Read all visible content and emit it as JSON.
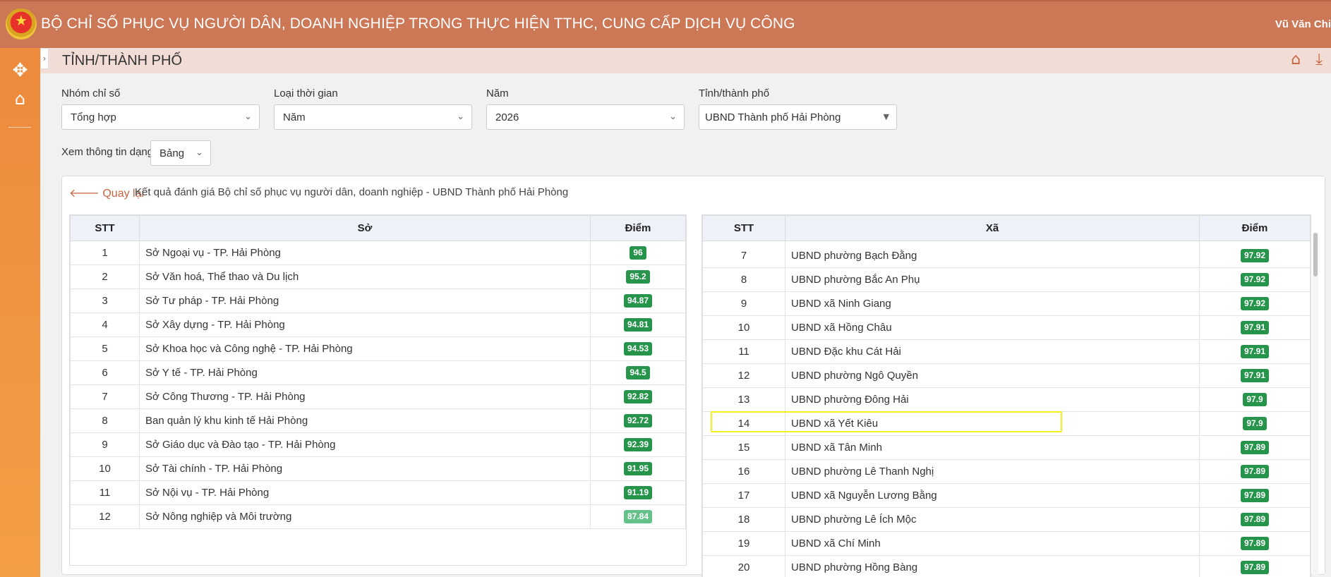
{
  "header": {
    "title": "BỘ CHỈ SỐ PHỤC VỤ NGƯỜI DÂN, DOANH NGHIỆP TRONG THỰC HIỆN TTHC, CUNG CẤP DỊCH VỤ CÔNG",
    "user": "Vũ Văn Chi",
    "emblem_icon": "national-emblem-icon"
  },
  "sidebar": {
    "items": [
      {
        "icon": "compass-icon"
      },
      {
        "icon": "home-icon"
      }
    ]
  },
  "subheader": {
    "title": "TỈNH/THÀNH PHỐ",
    "icons": [
      "home-icon",
      "download-icon"
    ]
  },
  "filters": {
    "group_label": "Nhóm chỉ số",
    "group_value": "Tổng hợp",
    "time_label": "Loại thời gian",
    "time_value": "Năm",
    "year_label": "Năm",
    "year_value": "2026",
    "province_label": "Tỉnh/thành phố",
    "province_value": "UBND Thành phố Hải Phòng",
    "view_label": "Xem thông tin dạng",
    "view_value": "Bảng"
  },
  "panel": {
    "back_label": "Quay lại",
    "description": "Kết quả đánh giá Bộ chỉ số phục vụ người dân, doanh nghiệp - UBND Thành phố Hải Phòng"
  },
  "left_table": {
    "headers": [
      "STT",
      "Sở",
      "Điểm"
    ],
    "rows": [
      {
        "stt": "1",
        "name": "Sở Ngoại vụ - TP. Hải Phòng",
        "score": "96"
      },
      {
        "stt": "2",
        "name": "Sở Văn hoá, Thể thao và Du lịch",
        "score": "95.2"
      },
      {
        "stt": "3",
        "name": "Sở Tư pháp - TP. Hải Phòng",
        "score": "94.87"
      },
      {
        "stt": "4",
        "name": "Sở Xây dựng - TP. Hải Phòng",
        "score": "94.81"
      },
      {
        "stt": "5",
        "name": "Sở Khoa học và Công nghệ - TP. Hải Phòng",
        "score": "94.53"
      },
      {
        "stt": "6",
        "name": "Sở Y tế - TP. Hải Phòng",
        "score": "94.5"
      },
      {
        "stt": "7",
        "name": "Sở Công Thương - TP. Hải Phòng",
        "score": "92.82"
      },
      {
        "stt": "8",
        "name": "Ban quản lý khu kinh tế Hải Phòng",
        "score": "92.72"
      },
      {
        "stt": "9",
        "name": "Sở Giáo dục và Đào tạo - TP. Hải Phòng",
        "score": "92.39"
      },
      {
        "stt": "10",
        "name": "Sở Tài chính - TP. Hải Phòng",
        "score": "91.95"
      },
      {
        "stt": "11",
        "name": "Sở Nội vụ - TP. Hải Phòng",
        "score": "91.19"
      },
      {
        "stt": "12",
        "name": "Sở Nông nghiệp và Môi trường",
        "score": "87.84"
      }
    ]
  },
  "right_table": {
    "headers": [
      "STT",
      "Xã",
      "Điểm"
    ],
    "rows": [
      {
        "stt": "7",
        "name": "UBND phường Bạch Đằng",
        "score": "97.92"
      },
      {
        "stt": "8",
        "name": "UBND phường Bắc An Phụ",
        "score": "97.92"
      },
      {
        "stt": "9",
        "name": "UBND xã Ninh Giang",
        "score": "97.92"
      },
      {
        "stt": "10",
        "name": "UBND xã Hồng Châu",
        "score": "97.91"
      },
      {
        "stt": "11",
        "name": "UBND Đặc khu Cát Hải",
        "score": "97.91"
      },
      {
        "stt": "12",
        "name": "UBND phường Ngô Quyền",
        "score": "97.91"
      },
      {
        "stt": "13",
        "name": "UBND phường Đông Hải",
        "score": "97.9"
      },
      {
        "stt": "14",
        "name": "UBND xã Yết Kiêu",
        "score": "97.9"
      },
      {
        "stt": "15",
        "name": "UBND xã Tân Minh",
        "score": "97.89"
      },
      {
        "stt": "16",
        "name": "UBND phường Lê Thanh Nghị",
        "score": "97.89"
      },
      {
        "stt": "17",
        "name": "UBND xã Nguyễn Lương Bằng",
        "score": "97.89"
      },
      {
        "stt": "18",
        "name": "UBND phường Lê Ích Mộc",
        "score": "97.89"
      },
      {
        "stt": "19",
        "name": "UBND xã Chí Minh",
        "score": "97.89"
      },
      {
        "stt": "20",
        "name": "UBND phường Hồng Bàng",
        "score": "97.89"
      }
    ]
  },
  "colors": {
    "header_bg": "#cc7755",
    "sidebar_bg": "#f39f45",
    "badge_green": "#26944a",
    "badge_light_green": "#66c08a",
    "highlight": "#f3f01e"
  }
}
